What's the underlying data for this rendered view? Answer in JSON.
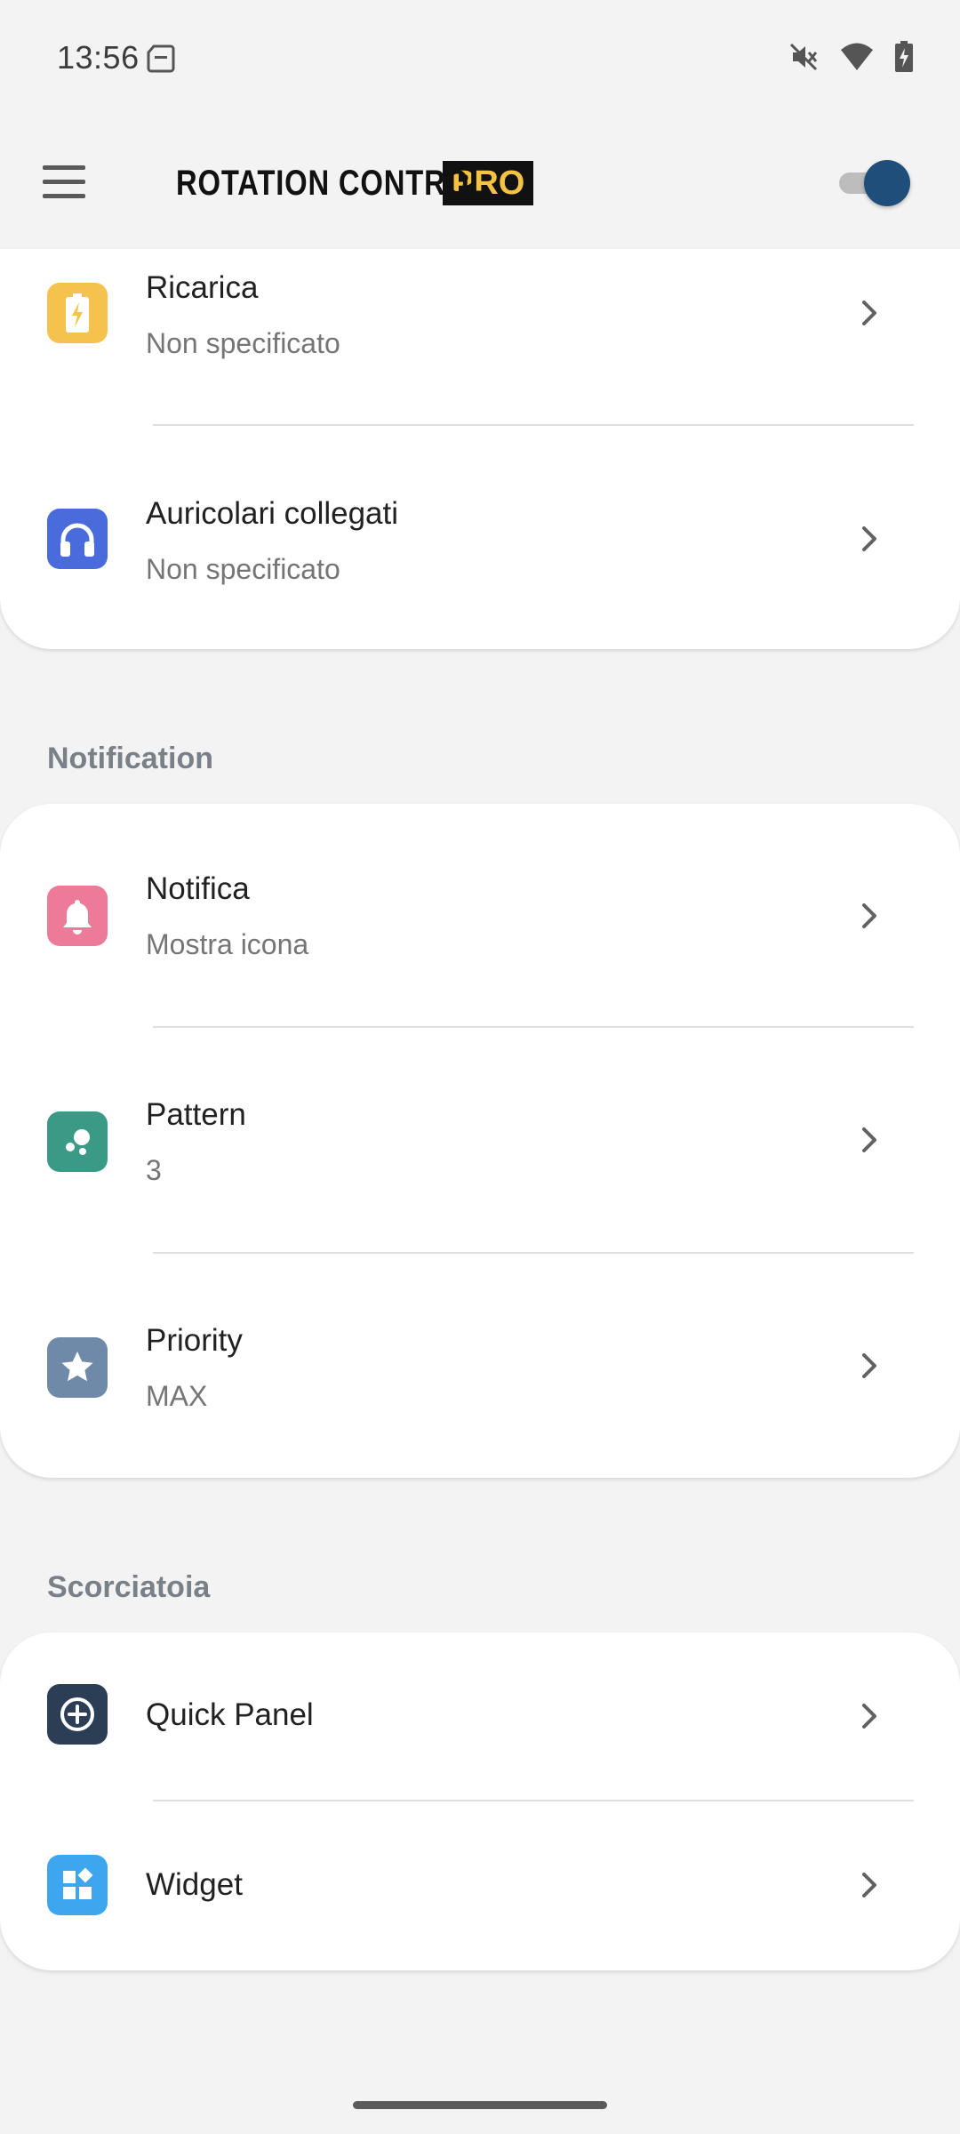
{
  "status_bar": {
    "time": "13:56",
    "icons": [
      "sd-card-icon",
      "mute-icon",
      "wifi-icon",
      "battery-charging-icon"
    ]
  },
  "app_bar": {
    "logo_text": "ROTATION CONTROL",
    "logo_badge": "PRO",
    "toggle_on": true,
    "accent": "#1f4e7a"
  },
  "card1": {
    "rows": [
      {
        "title": "Ricarica",
        "subtitle": "Non specificato",
        "icon": "battery-charging-icon",
        "icon_color": "#f6c24e"
      },
      {
        "title": "Auricolari collegati",
        "subtitle": "Non specificato",
        "icon": "headphones-icon",
        "icon_color": "#4a6bdc"
      }
    ]
  },
  "notification": {
    "header": "Notification",
    "rows": [
      {
        "title": "Notifica",
        "subtitle": "Mostra icona",
        "icon": "bell-icon",
        "icon_color": "#ec7a98"
      },
      {
        "title": "Pattern",
        "subtitle": "3",
        "icon": "dots-icon",
        "icon_color": "#3a9a86"
      },
      {
        "title": "Priority",
        "subtitle": "MAX",
        "icon": "star-icon",
        "icon_color": "#6f8aa8"
      }
    ]
  },
  "shortcut": {
    "header": "Scorciatoia",
    "rows": [
      {
        "title": "Quick Panel",
        "icon": "add-circle-icon",
        "icon_color": "#2c3e55"
      },
      {
        "title": "Widget",
        "icon": "widgets-icon",
        "icon_color": "#3ea6ee"
      }
    ]
  }
}
